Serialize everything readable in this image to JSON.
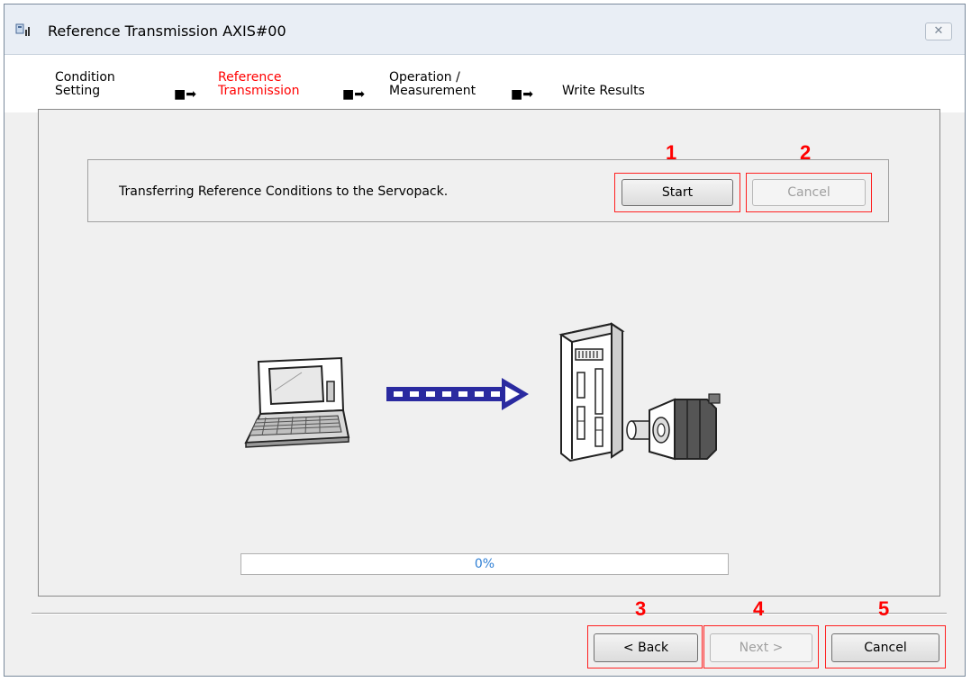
{
  "window": {
    "title": "Reference Transmission AXIS#00",
    "close_icon": "close-icon"
  },
  "steps": [
    {
      "label_line1": "Condition",
      "label_line2": "Setting",
      "active": false
    },
    {
      "label_line1": "Reference",
      "label_line2": "Transmission",
      "active": true
    },
    {
      "label_line1": "Operation /",
      "label_line2": "Measurement",
      "active": false
    },
    {
      "label_line1": "Write Results",
      "label_line2": "",
      "active": false
    }
  ],
  "step_arrow": "■➡",
  "transfer": {
    "message": "Transferring Reference Conditions to the Servopack.",
    "start_label": "Start",
    "cancel_label": "Cancel"
  },
  "progress": {
    "percent_text": "0%",
    "value": 0
  },
  "footer": {
    "back_label": "< Back",
    "next_label": "Next >",
    "cancel_label": "Cancel"
  },
  "callouts": {
    "start": "1",
    "cancel_top": "2",
    "back": "3",
    "next": "4",
    "cancel_bottom": "5"
  },
  "colors": {
    "active_step": "#ff0000",
    "callout": "#ff0000",
    "arrow": "#2a2aa0",
    "progress_text": "#2f7fd4"
  },
  "illustration": {
    "left_icon": "laptop-icon",
    "arrow_icon": "transfer-arrow-icon",
    "right_icon": "servopack-motor-icon"
  }
}
